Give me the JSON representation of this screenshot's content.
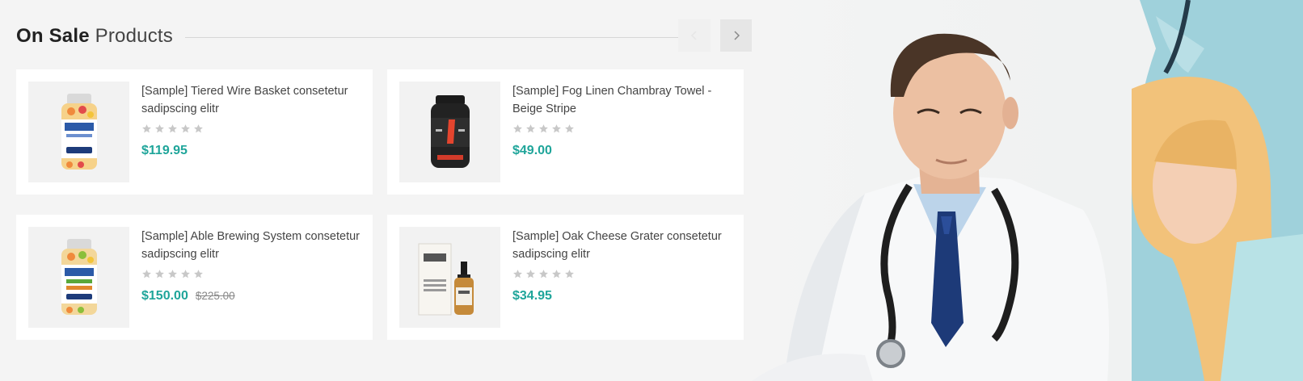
{
  "section": {
    "title_bold": "On Sale",
    "title_light": "Products",
    "prev_icon": "chevron-left-icon",
    "next_icon": "chevron-right-icon"
  },
  "colors": {
    "price": "#1fa59a",
    "star_empty": "#c8c8c8",
    "background": "#f4f4f4"
  },
  "products": [
    {
      "name": "[Sample] Tiered Wire Basket consetetur sadipscing elitr",
      "rating": 0,
      "price": "$119.95",
      "old_price": "",
      "image": "gummies-bottle-orange"
    },
    {
      "name": "[Sample] Fog Linen Chambray Towel - Beige Stripe",
      "rating": 0,
      "price": "$49.00",
      "old_price": "",
      "image": "black-supplement-tub"
    },
    {
      "name": "[Sample] Able Brewing System consetetur sadipscing elitr",
      "rating": 0,
      "price": "$150.00",
      "old_price": "$225.00",
      "image": "gummies-bottle-green"
    },
    {
      "name": "[Sample] Oak Cheese Grater consetetur sadipscing elitr",
      "rating": 0,
      "price": "$34.95",
      "old_price": "",
      "image": "oil-dropper-box"
    }
  ],
  "hero": {
    "image": "doctor-and-patient-photo"
  }
}
